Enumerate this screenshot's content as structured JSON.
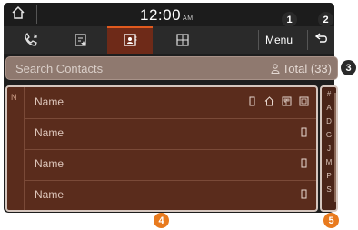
{
  "status_bar": {
    "time": "12:00",
    "ampm": "AM"
  },
  "tabs": [
    {
      "name": "recent-calls",
      "icon": "phone-recent-icon"
    },
    {
      "name": "favorites",
      "icon": "favorites-icon"
    },
    {
      "name": "contacts",
      "icon": "contacts-icon",
      "active": true
    },
    {
      "name": "keypad",
      "icon": "keypad-icon"
    }
  ],
  "header": {
    "menu_label": "Menu"
  },
  "search": {
    "placeholder": "Search Contacts",
    "total": "Total (33)"
  },
  "list": {
    "current_index": "N",
    "rows": [
      {
        "name": "Name",
        "icons": [
          "mobile-icon",
          "home-icon",
          "office-icon",
          "other-phone-icon"
        ]
      },
      {
        "name": "Name",
        "icons": [
          "mobile-icon"
        ]
      },
      {
        "name": "Name",
        "icons": [
          "mobile-icon"
        ]
      },
      {
        "name": "Name",
        "icons": [
          "mobile-icon"
        ]
      }
    ]
  },
  "index_bar": [
    "#",
    "A",
    "D",
    "G",
    "J",
    "M",
    "P",
    "S"
  ],
  "callouts": [
    "1",
    "2",
    "3",
    "4",
    "5"
  ],
  "colors": {
    "accent": "#e05a1e",
    "list_bg": "#5a2c1c",
    "search_bg": "#8f796f",
    "callout_orange": "#e87a1e"
  }
}
